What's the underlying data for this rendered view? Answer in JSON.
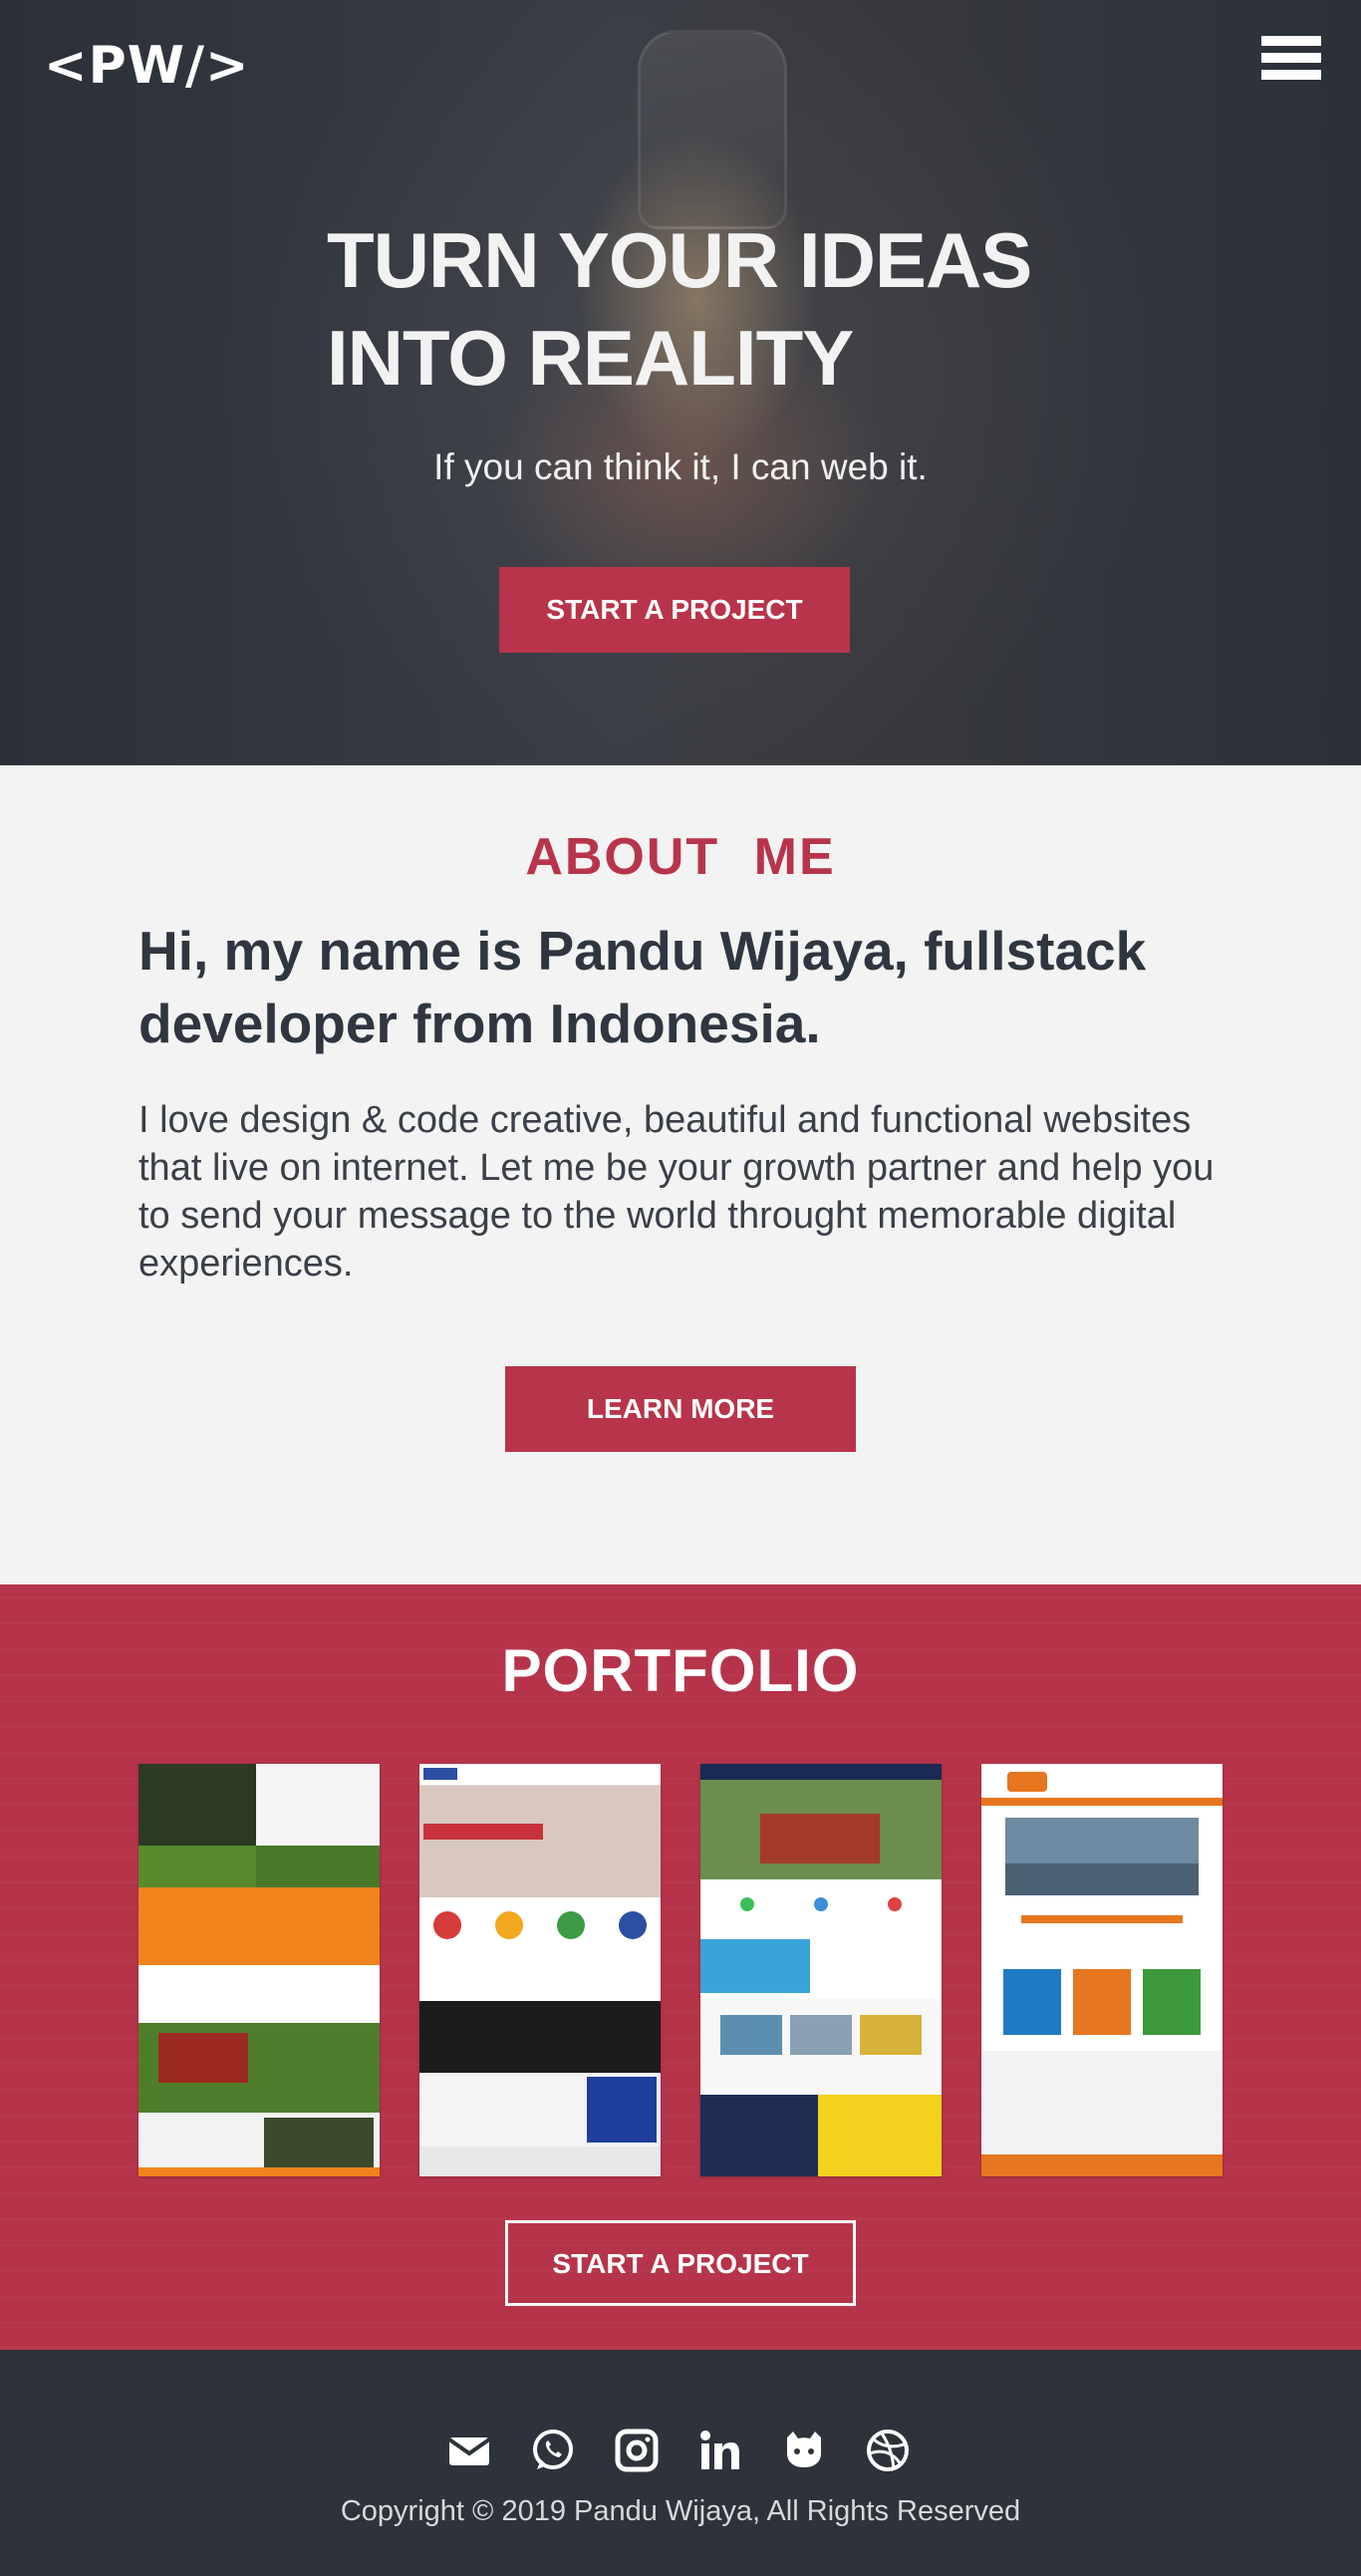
{
  "header": {
    "logo": "<PW/>",
    "menu_icon": "hamburger-menu-icon"
  },
  "hero": {
    "title_line1": "TURN YOUR IDEAS",
    "title_line2": "INTO REALITY",
    "subtitle": "If you can think it, I can web it.",
    "cta_label": "START A PROJECT"
  },
  "about": {
    "heading": "ABOUT ME",
    "lead": "Hi, my name is Pandu Wijaya, fullstack developer from Indonesia.",
    "text": "I love design & code creative, beautiful and functional websites that live on internet. Let me be your growth partner and help you to send your message to the world throught memorable digital experiences.",
    "button_label": "LEARN MORE"
  },
  "portfolio": {
    "heading": "PORTFOLIO",
    "items": [
      {
        "name": "lawnscaping-site-thumbnail",
        "accent": "#f0831c"
      },
      {
        "name": "zurich-site-thumbnail",
        "accent": "#2d4fa3"
      },
      {
        "name": "fraser-services-site-thumbnail",
        "accent": "#f3d11f"
      },
      {
        "name": "nepal-trekking-site-thumbnail",
        "accent": "#e6761f"
      }
    ],
    "button_label": "START A PROJECT"
  },
  "footer": {
    "social": [
      "mail-icon",
      "whatsapp-icon",
      "instagram-icon",
      "linkedin-icon",
      "github-icon",
      "dribbble-icon"
    ],
    "copyright": "Copyright © 2019 Pandu Wijaya, All Rights Reserved"
  },
  "colors": {
    "accent": "#b8344a",
    "dark": "#2e323b",
    "light": "#f3f3f3"
  }
}
